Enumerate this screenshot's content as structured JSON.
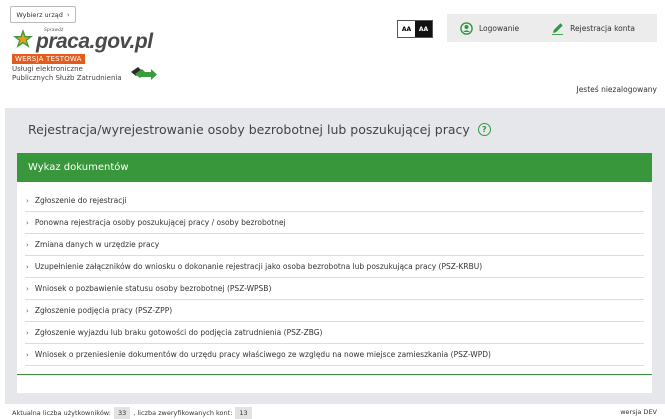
{
  "header": {
    "select_office": "Wybierz urząd",
    "logo": {
      "brand_small": "Sprawdź",
      "brand": "praca.gov.pl",
      "test_badge": "WERSJA TESTOWA",
      "subtitle_line1": "Usługi elektroniczne",
      "subtitle_line2": "Publicznych Służb Zatrudnienia"
    },
    "contrast": {
      "normal": "AA",
      "high": "AA"
    },
    "auth": {
      "login": "Logowanie",
      "register": "Rejestracja konta"
    },
    "user_status": "Jesteś niezalogowany"
  },
  "main": {
    "title": "Rejestracja/wyrejestrowanie osoby bezrobotnej lub poszukującej pracy",
    "docs_header": "Wykaz dokumentów",
    "documents": [
      "Zgłoszenie do rejestracji",
      "Ponowna rejestracja osoby poszukującej pracy / osoby bezrobotnej",
      "Zmiana danych w urzędzie pracy",
      "Uzupełnienie załączników do wniosku o dokonanie rejestracji jako osoba bezrobotna lub poszukująca pracy (PSZ-KRBU)",
      "Wniosek o pozbawienie statusu osoby bezrobotnej (PSZ-WPSB)",
      "Zgłoszenie podjęcia pracy (PSZ-ZPP)",
      "Zgłoszenie wyjazdu lub braku gotowości do podjęcia zatrudnienia (PSZ-ZBG)",
      "Wniosek o przeniesienie dokumentów do urzędu pracy właściwego ze względu na nowe miejsce zamieszkania (PSZ-WPD)"
    ]
  },
  "footer": {
    "users_label": "Aktualna liczba użytkowników:",
    "users_count": "33",
    "verified_label": ", liczba zweryfikowanych kont:",
    "verified_count": "13",
    "version": "wersja DEV"
  },
  "colors": {
    "accent_green": "#38973a",
    "test_badge": "#e35b1d"
  }
}
